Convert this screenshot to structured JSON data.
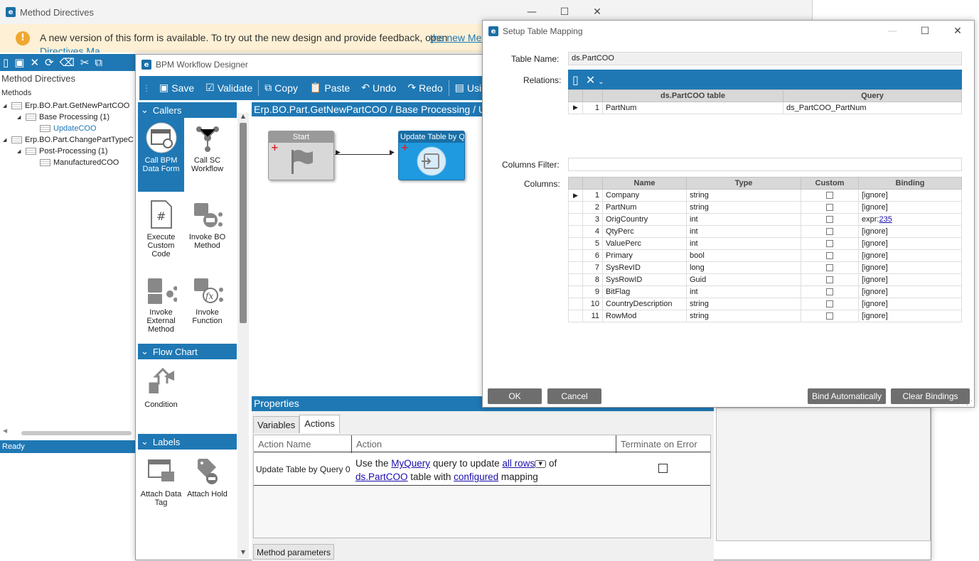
{
  "method_window": {
    "title": "Method Directives",
    "banner": "A new version of this form is available. To try out the new design and provide feedback, open",
    "banner_link": "the new Meth",
    "banner_line2": "Directives Ma...",
    "panel_title": "Method Directives",
    "tree_root": "Methods",
    "tree": [
      {
        "label": "Erp.BO.Part.GetNewPartCOO",
        "level": 1,
        "toggle": "◢"
      },
      {
        "label": "Base Processing (1)",
        "level": 2,
        "toggle": "◢"
      },
      {
        "label": "UpdateCOO",
        "level": 3,
        "toggle": ""
      },
      {
        "label": "Erp.BO.Part.ChangePartTypeC",
        "level": 1,
        "toggle": "◢"
      },
      {
        "label": "Post-Processing (1)",
        "level": 2,
        "toggle": "◢"
      },
      {
        "label": "ManufacturedCOO",
        "level": 3,
        "toggle": ""
      }
    ],
    "status": "Ready"
  },
  "bpm_window": {
    "title": "BPM Workflow Designer",
    "toolbar": {
      "save": "Save",
      "validate": "Validate",
      "copy": "Copy",
      "paste": "Paste",
      "undo": "Undo",
      "redo": "Redo",
      "using": "Usin"
    },
    "callers_header": "Callers",
    "callers": [
      {
        "label": "Call BPM Data Form",
        "icon": "form-icon"
      },
      {
        "label": "Call SC Workflow",
        "icon": "workflow-icon"
      },
      {
        "label": "Execute Custom Code",
        "icon": "code-file-icon"
      },
      {
        "label": "Invoke BO Method",
        "icon": "bo-method-icon"
      },
      {
        "label": "Invoke External Method",
        "icon": "external-method-icon"
      },
      {
        "label": "Invoke Function",
        "icon": "function-icon"
      }
    ],
    "flowchart_header": "Flow Chart",
    "flowchart_items": [
      {
        "label": "Condition",
        "icon": "condition-icon"
      }
    ],
    "labels_header": "Labels",
    "labels_items": [
      {
        "label": "Attach Data Tag",
        "icon": "data-tag-icon"
      },
      {
        "label": "Attach Hold",
        "icon": "hold-tag-icon"
      }
    ],
    "breadcrumb": "Erp.BO.Part.GetNewPartCOO / Base Processing / Upd",
    "nodes": {
      "start": "Start",
      "update": "Update Table by Q"
    },
    "properties": {
      "header": "Properties",
      "tabs": [
        "Variables",
        "Actions"
      ],
      "active_tab": "Actions",
      "columns": [
        "Action Name",
        "Action",
        "Terminate on Error"
      ],
      "row": {
        "name": "Update Table by Query 0",
        "t1": "Use the",
        "l1": "MyQuery",
        "t2": "query to update",
        "l2": "all rows",
        "t3": "of",
        "l3": "ds.PartCOO",
        "t4": "table with",
        "l4": "configured",
        "t5": "mapping"
      },
      "method_params_tab": "Method parameters"
    }
  },
  "mapping_dialog": {
    "title": "Setup Table Mapping",
    "table_name_label": "Table Name:",
    "table_name_value": "ds.PartCOO",
    "relations_label": "Relations:",
    "relations_columns": [
      "ds.PartCOO table",
      "Query"
    ],
    "relations_rows": [
      {
        "n": "1",
        "field": "PartNum",
        "query": "ds_PartCOO_PartNum"
      }
    ],
    "columns_filter_label": "Columns Filter:",
    "columns_filter_value": "",
    "columns_label": "Columns:",
    "columns_headers": [
      "Name",
      "Type",
      "Custom",
      "Binding"
    ],
    "columns_rows": [
      {
        "n": "1",
        "name": "Company",
        "type": "string",
        "binding": "[ignore]"
      },
      {
        "n": "2",
        "name": "PartNum",
        "type": "string",
        "binding": "[ignore]"
      },
      {
        "n": "3",
        "name": "OrigCountry",
        "type": "int",
        "binding": "expr:",
        "binding_link": "235"
      },
      {
        "n": "4",
        "name": "QtyPerc",
        "type": "int",
        "binding": "[ignore]"
      },
      {
        "n": "5",
        "name": "ValuePerc",
        "type": "int",
        "binding": "[ignore]"
      },
      {
        "n": "6",
        "name": "Primary",
        "type": "bool",
        "binding": "[ignore]"
      },
      {
        "n": "7",
        "name": "SysRevID",
        "type": "long",
        "binding": "[ignore]"
      },
      {
        "n": "8",
        "name": "SysRowID",
        "type": "Guid",
        "binding": "[ignore]"
      },
      {
        "n": "9",
        "name": "BitFlag",
        "type": "int",
        "binding": "[ignore]"
      },
      {
        "n": "10",
        "name": "CountryDescription",
        "type": "string",
        "binding": "[ignore]"
      },
      {
        "n": "11",
        "name": "RowMod",
        "type": "string",
        "binding": "[ignore]"
      }
    ],
    "buttons": {
      "ok": "OK",
      "cancel": "Cancel",
      "bind": "Bind Automatically",
      "clear": "Clear Bindings"
    }
  },
  "colors": {
    "accent": "#1f78b4",
    "banner": "#fdf0d5",
    "button_gray": "#6e6e6e"
  }
}
